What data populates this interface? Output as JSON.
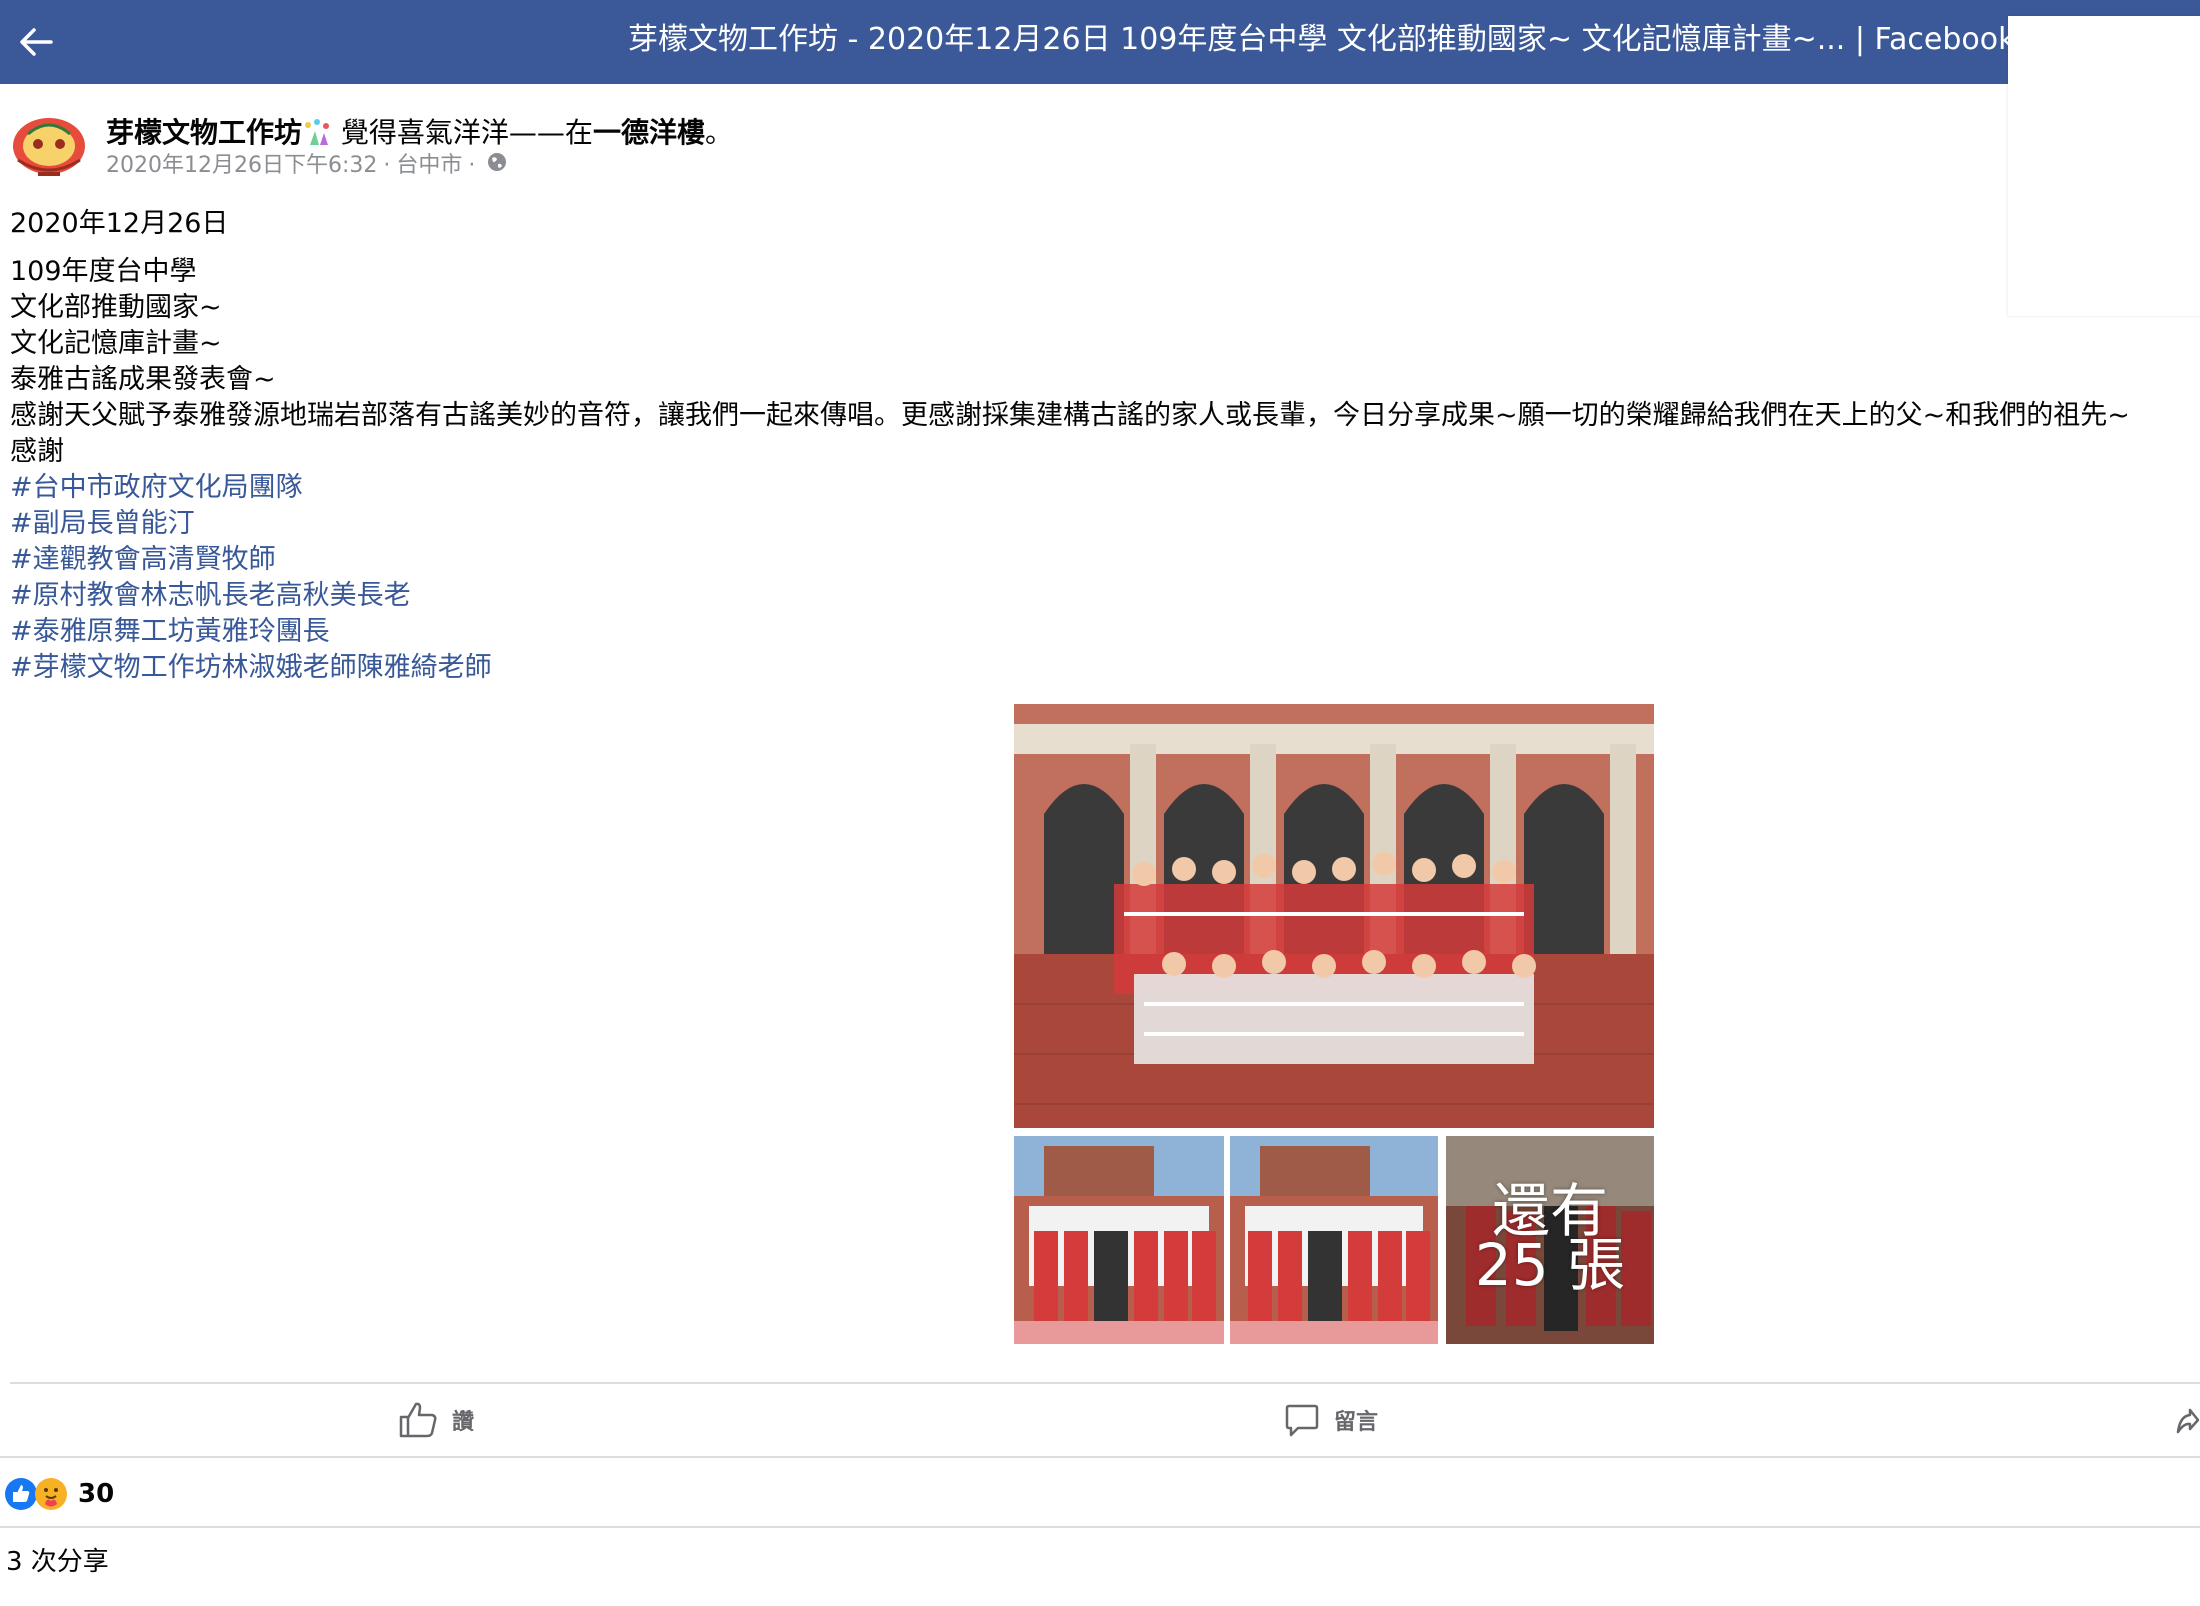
{
  "topbar": {
    "title": "芽檬文物工作坊 - 2020年12月26日 109年度台中學 文化部推動國家~ 文化記憶庫計畫~... | Facebook"
  },
  "post": {
    "page_name": "芽檬文物工作坊",
    "feeling_text": "覺得喜氣洋洋——在",
    "place": "一德洋樓",
    "period": "。",
    "timestamp": "2020年12月26日下午6:32",
    "location": "台中市",
    "separator": "·",
    "lines": [
      "2020年12月26日",
      "109年度台中學",
      "文化部推動國家~",
      "文化記憶庫計畫~",
      "泰雅古謠成果發表會~",
      "感謝天父賦予泰雅發源地瑞岩部落有古謠美妙的音符，讓我們一起來傳唱。更感謝採集建構古謠的家人或長輩，今日分享成果~願一切的榮耀歸給我們在天上的父~和我們的祖先~",
      "感謝"
    ],
    "hashtags": [
      "#台中市政府文化局團隊",
      "#副局長曾能汀",
      "#達觀教會高清賢牧師",
      "#原村教會林志帆長老高秋美長老",
      "#泰雅原舞工坊黃雅玲團長",
      "#芽檬文物工作坊林淑娥老師陳雅綺老師"
    ],
    "more_photos_label": "還有 25 張"
  },
  "actions": {
    "like_label": "讚",
    "comment_label": "留言"
  },
  "footer": {
    "reaction_count": "30",
    "shares_label": "3 次分享"
  },
  "colors": {
    "topbar": "#3b5998",
    "hashtag": "#385898",
    "meta": "#8a8d91",
    "like_blue": "#1877f2"
  },
  "icons": [
    "back-arrow-icon",
    "party-popper-icon",
    "globe-icon",
    "like-icon",
    "comment-icon",
    "share-icon",
    "like-reaction-icon",
    "care-reaction-icon"
  ]
}
